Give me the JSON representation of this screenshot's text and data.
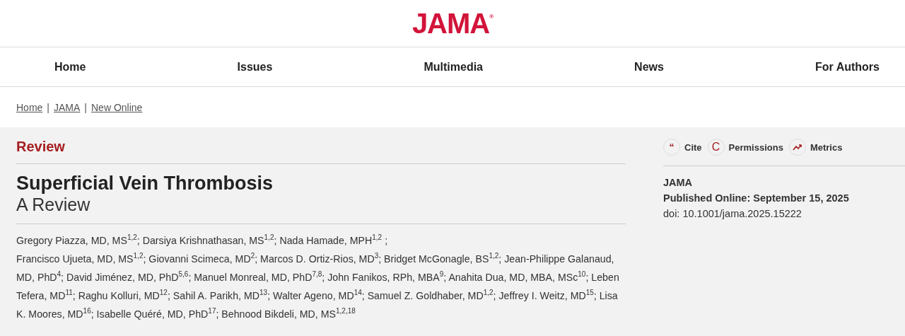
{
  "logo": "JAMA$^{®}$",
  "nav": [
    {
      "label": "Home"
    },
    {
      "label": "Issues"
    },
    {
      "label": "Multimedia"
    },
    {
      "label": "News"
    },
    {
      "label": "For Authors"
    }
  ],
  "breadcrumb": [
    "Home",
    "JAMA",
    "New Online"
  ],
  "breadcrumb_separator": "|",
  "article": {
    "type": "Review",
    "title": "Superficial Vein Thrombosis",
    "subtitle": "A Review",
    "authors": [
      "Gregory Piazza, MD, MS$^{1,2}$; Darsiya Krishnathasan, MS$^{1,2}$; Nada Hamade, MPH$^{1,2}$ ;",
      "Francisco Ujueta, MD, MS$^{1,2}$; Giovanni Scimeca, MD$^{2}$; Marcos D. Ortiz-Rios, MD$^{3}$; Bridget McGonagle, BS$^{1,2}$; Jean-Philippe Galanaud, MD, PhD$^{4}$; David Jiménez, MD, PhD$^{5,6}$; Manuel Monreal, MD, PhD$^{7,8}$; John Fanikos, RPh, MBA$^{9}$; Anahita Dua, MD, MBA, MSc$^{10}$; Leben Tefera, MD$^{11}$; Raghu Kolluri, MD$^{12}$; Sahil A. Parikh, MD$^{13}$; Walter Ageno, MD$^{14}$; Samuel Z. Goldhaber, MD$^{1,2}$; Jeffrey I. Weitz, MD$^{15}$; Lisa K. Moores, MD$^{16}$; Isabelle Quéré, MD, PhD$^{17}$; Behnood Bikdeli, MD, MS$^{1,2,18}$"
    ]
  },
  "tools": [
    {
      "kind": "quote",
      "icon": "“",
      "label": "Cite"
    },
    {
      "kind": "letter",
      "icon": "C",
      "label": "Permissions"
    },
    {
      "kind": "trend",
      "label": "Metrics"
    }
  ],
  "publication": {
    "journal": "JAMA",
    "published": "Published Online: September 15, 2025",
    "doi": "doi: 10.1001/jama.2025.15222"
  }
}
